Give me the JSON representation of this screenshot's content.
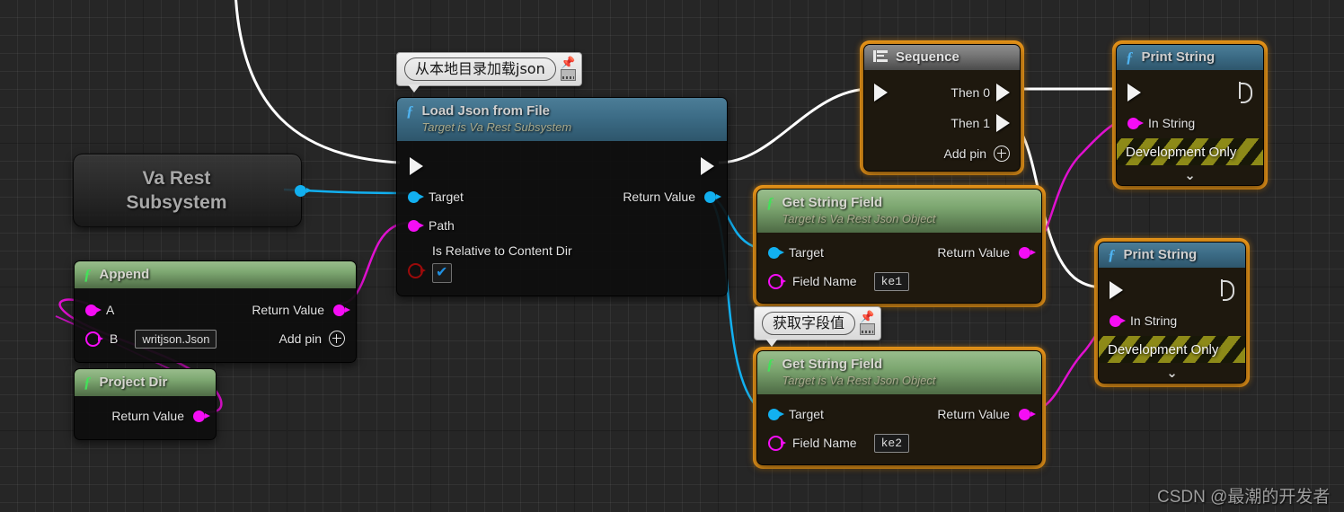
{
  "app": {
    "editor": "Unreal Engine Blueprint Graph",
    "watermark": "CSDN @最潮的开发者"
  },
  "comments": [
    {
      "id": "load-json-comment",
      "text": "从本地目录加载json",
      "pin_icon": "pin-icon",
      "grid_icon": "keyboard-icon"
    },
    {
      "id": "get-field-comment",
      "text": "获取字段值",
      "pin_icon": "pin-icon",
      "grid_icon": "keyboard-icon"
    }
  ],
  "nodes": {
    "va_rest_subsystem": {
      "label": "Va Rest Subsystem",
      "label_line1": "Va Rest",
      "label_line2": "Subsystem",
      "output_pin": "object-pin"
    },
    "append": {
      "title": "Append",
      "fx": "ƒ",
      "inputs": [
        {
          "label": "A",
          "pin": "string-pin-connected"
        },
        {
          "label": "B",
          "pin": "string-pin-hollow",
          "value": "writjson.Json"
        }
      ],
      "outputs": [
        {
          "label": "Return Value",
          "pin": "string-pin"
        }
      ],
      "add_pin_label": "Add pin"
    },
    "project_dir": {
      "title": "Project Dir",
      "fx": "ƒ",
      "outputs": [
        {
          "label": "Return Value",
          "pin": "string-pin"
        }
      ]
    },
    "load_json_from_file": {
      "title": "Load Json from File",
      "subtitle": "Target is Va Rest Subsystem",
      "fx": "ƒ",
      "inputs": [
        {
          "label": "Target",
          "pin": "object-pin"
        },
        {
          "label": "Path",
          "pin": "string-pin"
        },
        {
          "label": "Is Relative to Content Dir",
          "pin": "bool-pin",
          "checked": true,
          "check_glyph": "✔"
        }
      ],
      "outputs": [
        {
          "label": "Return Value",
          "pin": "object-pin"
        }
      ]
    },
    "sequence": {
      "title": "Sequence",
      "icon": "sequence-icon",
      "outputs": [
        {
          "label": "Then 0"
        },
        {
          "label": "Then 1"
        }
      ],
      "add_pin_label": "Add pin"
    },
    "get_string_field_1": {
      "title": "Get String Field",
      "subtitle": "Target is Va Rest Json Object",
      "fx": "ƒ",
      "inputs": [
        {
          "label": "Target",
          "pin": "object-pin"
        },
        {
          "label": "Field Name",
          "pin": "string-pin-hollow",
          "value": "ke1"
        }
      ],
      "outputs": [
        {
          "label": "Return Value",
          "pin": "string-pin"
        }
      ]
    },
    "get_string_field_2": {
      "title": "Get String Field",
      "subtitle": "Target is Va Rest Json Object",
      "fx": "ƒ",
      "inputs": [
        {
          "label": "Target",
          "pin": "object-pin"
        },
        {
          "label": "Field Name",
          "pin": "string-pin-hollow",
          "value": "ke2"
        }
      ],
      "outputs": [
        {
          "label": "Return Value",
          "pin": "string-pin"
        }
      ]
    },
    "print_string_1": {
      "title": "Print String",
      "fx": "ƒ",
      "inputs": [
        {
          "label": "In String",
          "pin": "string-pin"
        }
      ],
      "dev_only_label": "Development Only",
      "expand_glyph": "⌄"
    },
    "print_string_2": {
      "title": "Print String",
      "fx": "ƒ",
      "inputs": [
        {
          "label": "In String",
          "pin": "string-pin"
        }
      ],
      "dev_only_label": "Development Only",
      "expand_glyph": "⌄"
    }
  },
  "colors": {
    "selection": "#f09a1a",
    "exec_wire": "#ffffff",
    "object_pin": "#12b0f0",
    "string_pin": "#f50df5",
    "bool_pin": "#9b0a0a",
    "canvas": "#262626",
    "dev_only_stripe": "#8d8a18"
  }
}
